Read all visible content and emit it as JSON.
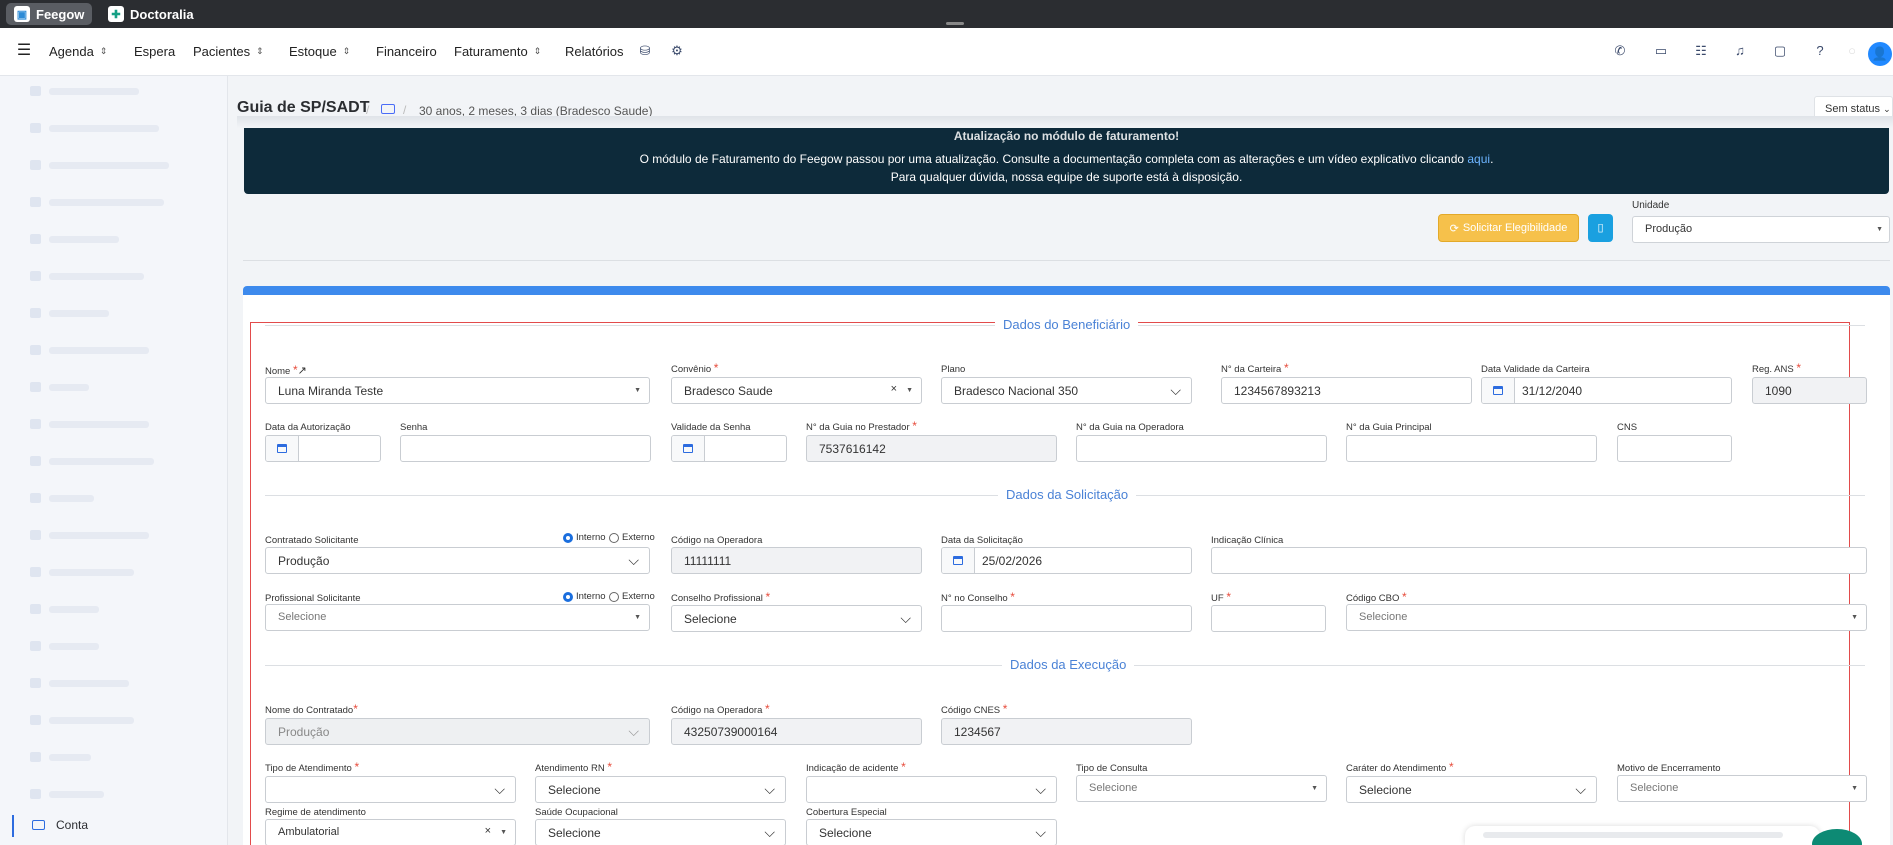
{
  "apps": [
    {
      "name": "Feegow"
    },
    {
      "name": "Doctoralia"
    }
  ],
  "nav": {
    "menu_icon": "hamburger-icon",
    "items": [
      {
        "label": "Agenda",
        "chevron": true
      },
      {
        "label": "Espera",
        "chevron": false
      },
      {
        "label": "Pacientes",
        "chevron": true
      },
      {
        "label": "Estoque",
        "chevron": true
      },
      {
        "label": "Financeiro",
        "chevron": false
      },
      {
        "label": "Faturamento",
        "chevron": true
      },
      {
        "label": "Relatórios",
        "chevron": false
      }
    ],
    "right_icons": [
      "phone-icon",
      "inbox-icon",
      "checklist-icon",
      "bell-icon",
      "chat-icon",
      "help-icon",
      "user-icon"
    ]
  },
  "sidebar": {
    "account_label": "Conta"
  },
  "page": {
    "title": "Guia de SP/SADT",
    "breadcrumb_sep": "/",
    "patient_info": "30 anos, 2 meses, 3 dias (Bradesco Saude)",
    "status": "Sem status"
  },
  "banner": {
    "title": "Atualização no módulo de faturamento!",
    "line1_pre": "O módulo de Faturamento do Feegow passou por uma atualização. Consulte a documentação completa com as alterações e um vídeo explicativo clicando ",
    "line1_link": "aqui",
    "line1_post": ".",
    "line2": "Para qualquer dúvida, nossa equipe de suporte está à disposição."
  },
  "actions": {
    "eligibility_label": "Solicitar Elegibilidade",
    "unidade_label": "Unidade",
    "unidade_value": "Produção"
  },
  "sections": {
    "beneficiario": "Dados do Beneficiário",
    "solicitacao": "Dados da Solicitação",
    "execucao": "Dados da Execução"
  },
  "beneficiario": {
    "nome": {
      "label": "Nome",
      "value": "Luna Miranda Teste"
    },
    "convenio": {
      "label": "Convênio",
      "value": "Bradesco Saude"
    },
    "plano": {
      "label": "Plano",
      "value": "Bradesco Nacional 350"
    },
    "carteira": {
      "label": "N° da Carteira",
      "value": "1234567893213"
    },
    "validade_carteira": {
      "label": "Data Validade da Carteira",
      "value": "31/12/2040"
    },
    "reg_ans": {
      "label": "Reg. ANS",
      "value": "1090"
    },
    "data_autorizacao": {
      "label": "Data da Autorização",
      "value": ""
    },
    "senha": {
      "label": "Senha",
      "value": ""
    },
    "validade_senha": {
      "label": "Validade da Senha",
      "value": ""
    },
    "guia_prestador": {
      "label": "N° da Guia no Prestador",
      "value": "7537616142"
    },
    "guia_operadora": {
      "label": "N° da Guia na Operadora",
      "value": ""
    },
    "guia_principal": {
      "label": "N° da Guia Principal",
      "value": ""
    },
    "cns": {
      "label": "CNS",
      "value": ""
    }
  },
  "solicitacao": {
    "contratado": {
      "label": "Contratado Solicitante",
      "value": "Produção"
    },
    "radio_interno": "Interno",
    "radio_externo": "Externo",
    "codigo_operadora": {
      "label": "Código na Operadora",
      "value": "11111111"
    },
    "data_solicitacao": {
      "label": "Data da Solicitação",
      "value": "25/02/2026"
    },
    "indicacao_clinica": {
      "label": "Indicação Clínica",
      "value": ""
    },
    "profissional": {
      "label": "Profissional Solicitante",
      "placeholder": "Selecione"
    },
    "conselho": {
      "label": "Conselho Profissional",
      "value": "Selecione"
    },
    "n_conselho": {
      "label": "N° no Conselho",
      "value": ""
    },
    "uf": {
      "label": "UF",
      "value": ""
    },
    "cbo": {
      "label": "Código CBO",
      "placeholder": "Selecione"
    }
  },
  "execucao": {
    "nome_contratado": {
      "label": "Nome do Contratado",
      "value": "Produção"
    },
    "codigo_operadora": {
      "label": "Código na Operadora",
      "value": "43250739000164"
    },
    "cnes": {
      "label": "Código CNES",
      "value": "1234567"
    },
    "tipo_atendimento": {
      "label": "Tipo de Atendimento",
      "value": ""
    },
    "atendimento_rn": {
      "label": "Atendimento RN",
      "value": "Selecione"
    },
    "indicacao_acidente": {
      "label": "Indicação de acidente",
      "value": ""
    },
    "tipo_consulta": {
      "label": "Tipo de Consulta",
      "placeholder": "Selecione"
    },
    "carater": {
      "label": "Caráter do Atendimento",
      "value": "Selecione"
    },
    "motivo_encerramento": {
      "label": "Motivo de Encerramento",
      "placeholder": "Selecione"
    },
    "regime": {
      "label": "Regime de atendimento",
      "value": "Ambulatorial"
    },
    "saude_ocupacional": {
      "label": "Saúde Ocupacional",
      "value": "Selecione"
    },
    "cobertura_especial": {
      "label": "Cobertura Especial",
      "value": "Selecione"
    }
  }
}
